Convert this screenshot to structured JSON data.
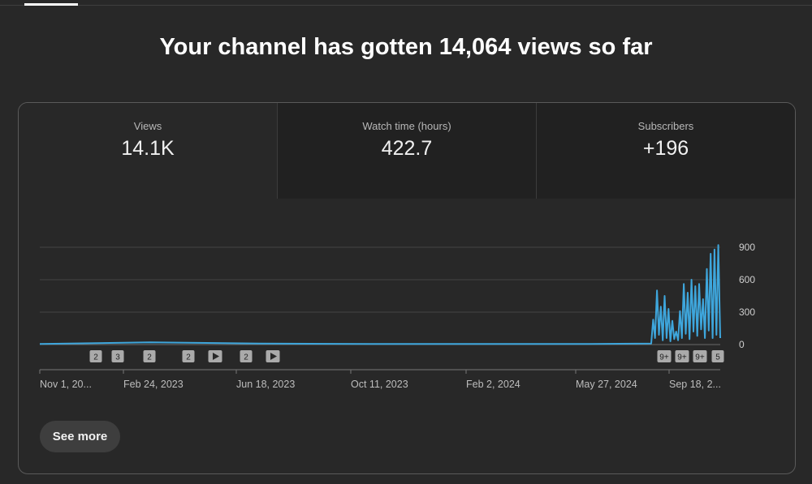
{
  "page": {
    "headline": "Your channel has gotten 14,064 views so far"
  },
  "metrics": [
    {
      "label": "Views",
      "value": "14.1K",
      "selected": true
    },
    {
      "label": "Watch time (hours)",
      "value": "422.7",
      "selected": false
    },
    {
      "label": "Subscribers",
      "value": "+196",
      "selected": false
    }
  ],
  "colors": {
    "line": "#3ea6dc",
    "background": "#282828",
    "tab_background": "#212121"
  },
  "chart_data": {
    "type": "line",
    "series": [
      {
        "x": [
          "2022-11-01",
          "2023-02-24",
          "2023-06-18",
          "2023-10-11",
          "2024-02-02",
          "2024-05-27",
          "2024-07-31",
          "2024-08-02",
          "2024-08-04",
          "2024-08-06",
          "2024-08-08",
          "2024-08-10",
          "2024-08-12",
          "2024-08-14",
          "2024-08-16",
          "2024-08-18",
          "2024-08-20",
          "2024-08-22",
          "2024-08-24",
          "2024-08-26",
          "2024-08-28",
          "2024-08-30",
          "2024-09-01",
          "2024-09-03",
          "2024-09-05",
          "2024-09-07",
          "2024-09-09",
          "2024-09-11",
          "2024-09-13",
          "2024-09-15",
          "2024-09-17",
          "2024-09-19",
          "2024-09-21",
          "2024-09-23",
          "2024-09-25",
          "2024-09-27",
          "2024-09-29",
          "2024-10-01",
          "2024-10-03",
          "2024-10-05",
          "2024-10-07",
          "2024-10-09",
          "2024-10-11"
        ],
        "y": [
          5,
          20,
          10,
          5,
          5,
          5,
          10,
          230,
          60,
          500,
          90,
          350,
          40,
          450,
          60,
          330,
          30,
          220,
          50,
          120,
          40,
          310,
          60,
          560,
          100,
          480,
          50,
          600,
          120,
          540,
          80,
          560,
          140,
          420,
          60,
          700,
          130,
          840,
          60,
          880,
          90,
          920,
          60
        ]
      }
    ],
    "x_tick_labels": [
      "Nov 1, 20...",
      "Feb 24, 2023",
      "Jun 18, 2023",
      "Oct 11, 2023",
      "Feb 2, 2024",
      "May 27, 2024",
      "Sep 18, 2..."
    ],
    "y_ticks": [
      0,
      300,
      600,
      900
    ],
    "ylim": [
      0,
      900
    ],
    "grid": true,
    "markers": [
      "2",
      "3",
      "2",
      "2",
      "play",
      "2",
      "play",
      "9+",
      "9+",
      "9+",
      "5"
    ]
  },
  "actions": {
    "see_more_label": "See more"
  }
}
